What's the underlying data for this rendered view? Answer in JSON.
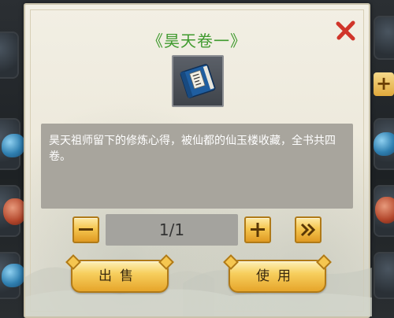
{
  "dialog": {
    "title": "《昊天卷一》",
    "item_icon": "blue-book-icon",
    "description": "昊天祖师留下的修炼心得，被仙都的仙玉楼收藏，全书共四卷。",
    "quantity": "1/1",
    "sell_label": "出售",
    "use_label": "使用"
  },
  "colors": {
    "title": "#3f9a2e",
    "close": "#d0352a",
    "button_gold": "#f5c650"
  }
}
